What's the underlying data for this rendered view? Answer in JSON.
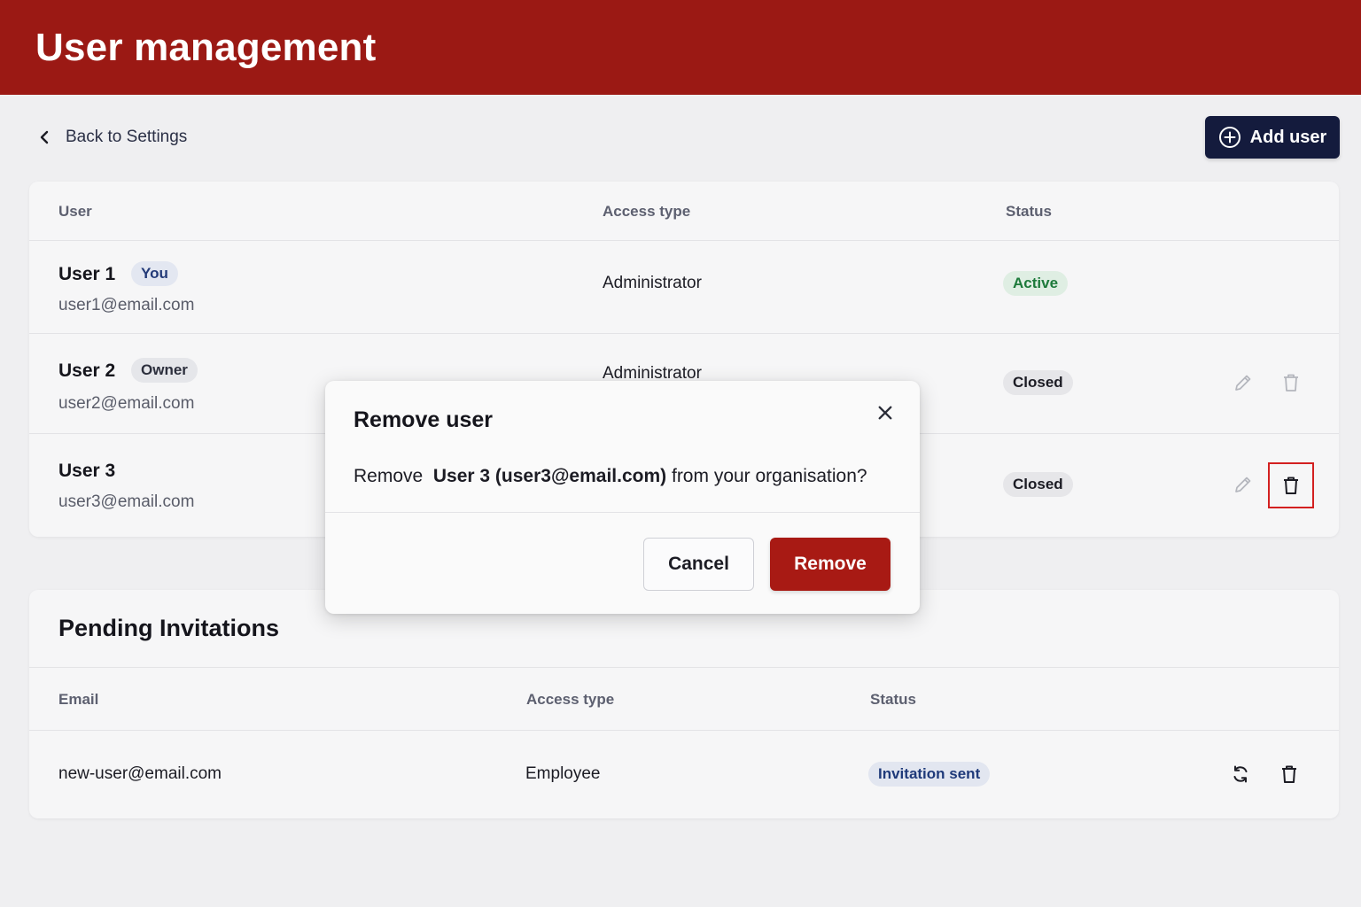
{
  "header": {
    "title": "User management"
  },
  "nav": {
    "back_label": "Back to Settings",
    "add_user_label": "Add user"
  },
  "users_table": {
    "columns": [
      "User",
      "Access type",
      "Status"
    ],
    "rows": [
      {
        "name": "User 1",
        "badge": "You",
        "email": "user1@email.com",
        "access": "Administrator",
        "status": "Active"
      },
      {
        "name": "User 2",
        "badge": "Owner",
        "email": "user2@email.com",
        "access": "Administrator",
        "status": "Closed"
      },
      {
        "name": "User 3",
        "badge": "",
        "email": "user3@email.com",
        "access": "",
        "status": "Closed"
      }
    ]
  },
  "pending": {
    "title": "Pending Invitations",
    "columns": [
      "Email",
      "Access type",
      "Status"
    ],
    "rows": [
      {
        "email": "new-user@email.com",
        "access": "Employee",
        "status": "Invitation sent"
      }
    ]
  },
  "modal": {
    "title": "Remove user",
    "message_prefix": "Remove",
    "message_target": "User 3 (user3@email.com)",
    "message_suffix": "from your organisation?",
    "cancel_label": "Cancel",
    "remove_label": "Remove"
  },
  "icons": {
    "back": "chevron-left-icon",
    "add": "plus-circle-icon",
    "edit": "pencil-icon",
    "delete": "trash-icon",
    "resend": "refresh-icon",
    "close": "close-icon"
  },
  "colors": {
    "brand_header": "#9b1914",
    "primary_button": "#141b3d",
    "danger_button": "#a81a14",
    "focus_ring": "#d32020",
    "status_active": "#1d7a3b"
  }
}
